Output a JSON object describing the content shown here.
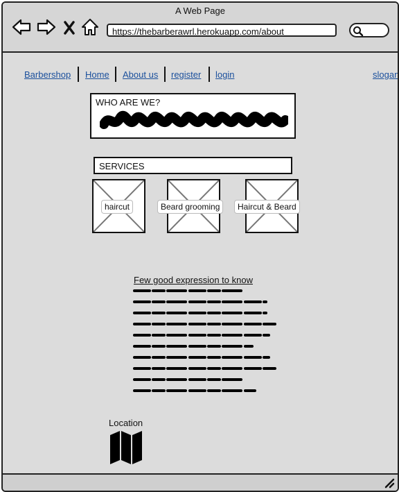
{
  "window": {
    "title": "A Web Page"
  },
  "browser": {
    "url": "https://thebarberawrl.herokuapp.com/about",
    "back_icon": "back-arrow-icon",
    "forward_icon": "forward-arrow-icon",
    "stop_icon": "close-icon",
    "home_icon": "home-icon",
    "search_icon": "search-icon"
  },
  "nav": {
    "items": [
      "Barbershop",
      "Home",
      "About us",
      "register",
      "login"
    ],
    "slogan": "slogan"
  },
  "about": {
    "heading": "WHO ARE WE?"
  },
  "services": {
    "heading": "SERVICES",
    "items": [
      "haircut",
      "Beard grooming",
      "Haircut  & Beard"
    ]
  },
  "expressions": {
    "title": "Few good expression to know"
  },
  "location": {
    "label": "Location",
    "icon": "map-icon"
  },
  "colors": {
    "link": "#1a4f9c",
    "background": "#dcdcdc"
  }
}
